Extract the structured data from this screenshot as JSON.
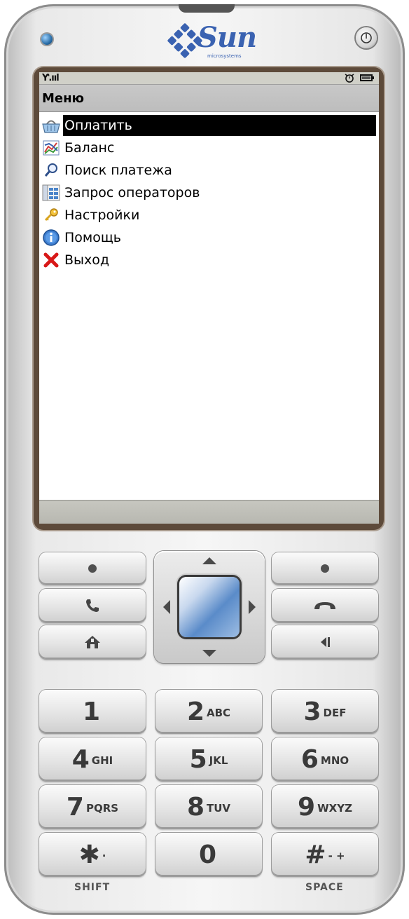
{
  "brand": {
    "name": "Sun",
    "subtitle": "microsystems"
  },
  "screen": {
    "title": "Меню",
    "menu_items": [
      {
        "label": "Оплатить",
        "icon": "basket-icon",
        "selected": true
      },
      {
        "label": "Баланс",
        "icon": "chart-icon",
        "selected": false
      },
      {
        "label": "Поиск платежа",
        "icon": "magnifier-icon",
        "selected": false
      },
      {
        "label": "Запрос операторов",
        "icon": "table-icon",
        "selected": false
      },
      {
        "label": "Настройки",
        "icon": "key-icon",
        "selected": false
      },
      {
        "label": "Помощь",
        "icon": "info-icon",
        "selected": false
      },
      {
        "label": "Выход",
        "icon": "exit-icon",
        "selected": false
      }
    ]
  },
  "keypad": {
    "keys": [
      {
        "digit": "1",
        "letters": ""
      },
      {
        "digit": "2",
        "letters": "ABC"
      },
      {
        "digit": "3",
        "letters": "DEF"
      },
      {
        "digit": "4",
        "letters": "GHI"
      },
      {
        "digit": "5",
        "letters": "JKL"
      },
      {
        "digit": "6",
        "letters": "MNO"
      },
      {
        "digit": "7",
        "letters": "PQRS"
      },
      {
        "digit": "8",
        "letters": "TUV"
      },
      {
        "digit": "9",
        "letters": "WXYZ"
      },
      {
        "digit": "✱",
        "letters": "·"
      },
      {
        "digit": "0",
        "letters": ""
      },
      {
        "digit": "#",
        "letters": "- +"
      }
    ],
    "shift_label": "SHIFT",
    "space_label": "SPACE"
  },
  "colors": {
    "selection_bg": "#000000",
    "selection_fg": "#ffffff",
    "brand_blue": "#3a62b1"
  }
}
